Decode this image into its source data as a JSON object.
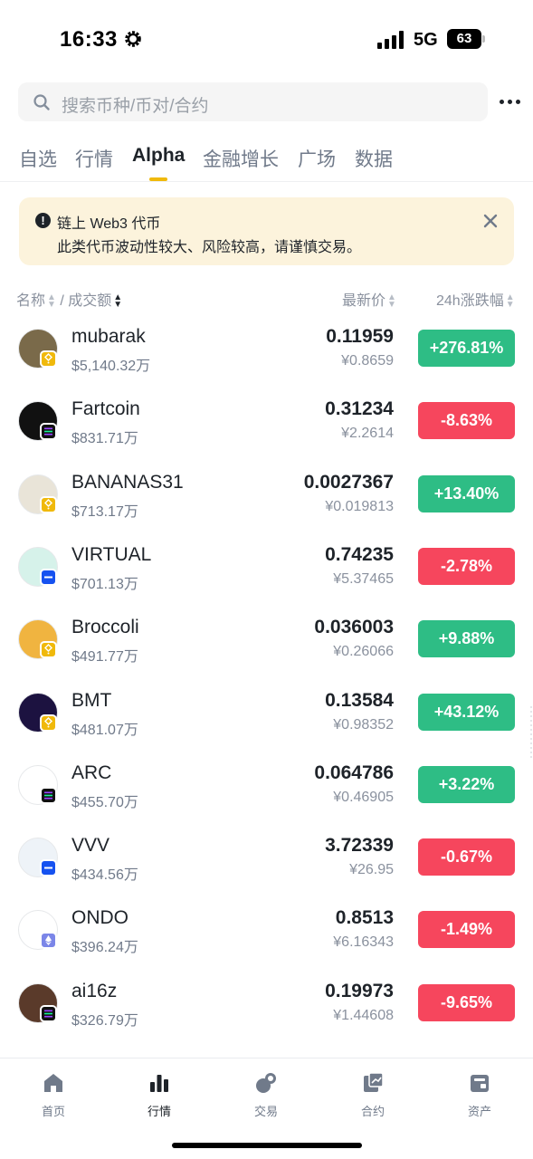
{
  "status_bar": {
    "time": "16:33",
    "network": "5G",
    "battery": "63"
  },
  "search": {
    "placeholder": "搜索币种/币对/合约"
  },
  "tabs": [
    {
      "label": "自选"
    },
    {
      "label": "行情"
    },
    {
      "label": "Alpha",
      "active": true
    },
    {
      "label": "金融增长"
    },
    {
      "label": "广场"
    },
    {
      "label": "数据"
    }
  ],
  "notice": {
    "title": "链上 Web3 代币",
    "body": "此类代币波动性较大、风险较高，请谨慎交易。"
  },
  "list_header": {
    "name": "名称",
    "separator": "/",
    "volume": "成交额",
    "price": "最新价",
    "change": "24h涨跌幅"
  },
  "coins": [
    {
      "name": "mubarak",
      "volume": "$5,140.32万",
      "price": "0.11959",
      "price_cny": "¥0.8659",
      "change": "+276.81%",
      "direction": "up",
      "chain": "bnb-chain-icon",
      "logo_color": "#7a6a4a"
    },
    {
      "name": "Fartcoin",
      "volume": "$831.71万",
      "price": "0.31234",
      "price_cny": "¥2.2614",
      "change": "-8.63%",
      "direction": "down",
      "chain": "solana-chain-icon",
      "logo_color": "#111111"
    },
    {
      "name": "BANANAS31",
      "volume": "$713.17万",
      "price": "0.0027367",
      "price_cny": "¥0.019813",
      "change": "+13.40%",
      "direction": "up",
      "chain": "bnb-chain-icon",
      "logo_color": "#e9e4d8"
    },
    {
      "name": "VIRTUAL",
      "volume": "$701.13万",
      "price": "0.74235",
      "price_cny": "¥5.37465",
      "change": "-2.78%",
      "direction": "down",
      "chain": "base-chain-icon",
      "logo_color": "#d6f2ea"
    },
    {
      "name": "Broccoli",
      "volume": "$491.77万",
      "price": "0.036003",
      "price_cny": "¥0.26066",
      "change": "+9.88%",
      "direction": "up",
      "chain": "bnb-chain-icon",
      "logo_color": "#f0b440"
    },
    {
      "name": "BMT",
      "volume": "$481.07万",
      "price": "0.13584",
      "price_cny": "¥0.98352",
      "change": "+43.12%",
      "direction": "up",
      "chain": "bnb-chain-icon",
      "logo_color": "#1c1240"
    },
    {
      "name": "ARC",
      "volume": "$455.70万",
      "price": "0.064786",
      "price_cny": "¥0.46905",
      "change": "+3.22%",
      "direction": "up",
      "chain": "solana-chain-icon",
      "logo_color": "#ffffff"
    },
    {
      "name": "VVV",
      "volume": "$434.56万",
      "price": "3.72339",
      "price_cny": "¥26.95",
      "change": "-0.67%",
      "direction": "down",
      "chain": "base-chain-icon",
      "logo_color": "#eef3f8"
    },
    {
      "name": "ONDO",
      "volume": "$396.24万",
      "price": "0.8513",
      "price_cny": "¥6.16343",
      "change": "-1.49%",
      "direction": "down",
      "chain": "ethereum-chain-icon",
      "logo_color": "#ffffff"
    },
    {
      "name": "ai16z",
      "volume": "$326.79万",
      "price": "0.19973",
      "price_cny": "¥1.44608",
      "change": "-9.65%",
      "direction": "down",
      "chain": "solana-chain-icon",
      "logo_color": "#5a3a2a"
    }
  ],
  "nav": [
    {
      "label": "首页",
      "icon": "home-icon"
    },
    {
      "label": "行情",
      "icon": "markets-icon",
      "active": true
    },
    {
      "label": "交易",
      "icon": "trade-icon"
    },
    {
      "label": "合约",
      "icon": "futures-icon"
    },
    {
      "label": "资产",
      "icon": "wallet-icon"
    }
  ],
  "colors": {
    "up": "#2ebd85",
    "down": "#f6465d",
    "accent": "#f0b90b",
    "notice_bg": "#fcf3dc"
  }
}
